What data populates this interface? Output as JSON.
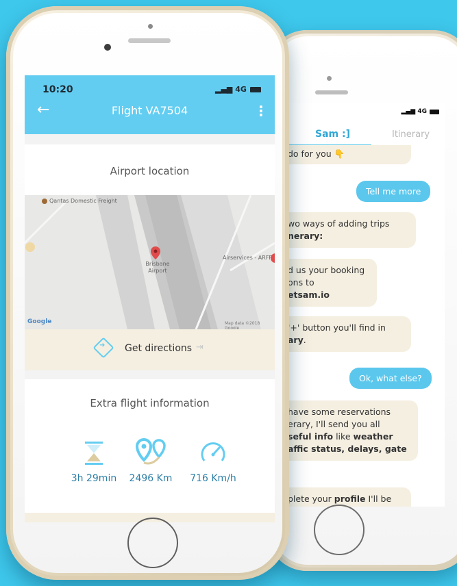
{
  "back_phone": {
    "status": {
      "signal": "4G"
    },
    "tabs": [
      {
        "label": "Sam :]"
      },
      {
        "label": "Itinerary"
      }
    ],
    "messages": [
      {
        "from": "bot",
        "text": "do for you 👇"
      },
      {
        "from": "user",
        "text": "Tell me more"
      },
      {
        "from": "bot",
        "text": "wo ways of adding trips",
        "bold": "nerary:"
      },
      {
        "from": "bot",
        "line1": "d us your booking",
        "line2": "ons to",
        "bold": "etsam.io"
      },
      {
        "from": "bot",
        "line1": "'+' button you'll find in",
        "bold": "ary",
        "tail": "."
      },
      {
        "from": "user",
        "text": "Ok, what else?"
      },
      {
        "from": "bot",
        "line1": "have some reservations",
        "line2": "erary, I'll send you all",
        "b3": "seful info",
        "t3": " like ",
        "b3b": "weather",
        "b4": "affic status, delays, gate"
      },
      {
        "from": "bot",
        "line1": "plete your",
        "bold": "profile",
        "tail": " I'll be"
      }
    ]
  },
  "front_phone": {
    "status": {
      "time": "10:20",
      "signal": "4G"
    },
    "header": {
      "title": "Flight VA7504",
      "back_icon": "back-arrow-icon",
      "menu_icon": "kebab-menu-icon"
    },
    "airport_card": {
      "title": "Airport location",
      "map": {
        "labels": {
          "freight": "Qantas Domestic Freight",
          "airport": "Brisbane Airport",
          "arff": "Airservices - ARFF",
          "google": "Google",
          "map_data": "Map data ©2018 Google"
        }
      },
      "directions_label": "Get directions"
    },
    "extra_card": {
      "title": "Extra flight information",
      "stats": [
        {
          "icon": "hourglass-icon",
          "value": "3h 29min"
        },
        {
          "icon": "route-pins-icon",
          "value": "2496 Km"
        },
        {
          "icon": "speedometer-icon",
          "value": "716 Km/h"
        }
      ]
    }
  },
  "colors": {
    "background": "#3ec8ec",
    "accent": "#63cdf1",
    "cream": "#f5efe1",
    "stat_text": "#2d7fa6",
    "map_pin": "#e04b4b"
  }
}
